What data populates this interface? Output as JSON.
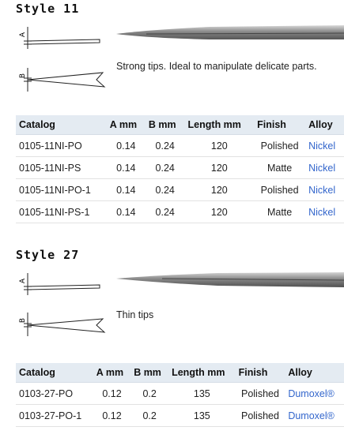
{
  "styles": [
    {
      "title": "Style 11",
      "description": "Strong tips. Ideal to manipulate delicate parts.",
      "table": {
        "headers": [
          "Catalog",
          "A mm",
          "B mm",
          "Length mm",
          "Finish",
          "Alloy"
        ],
        "rows": [
          [
            "0105-11NI-PO",
            "0.14",
            "0.24",
            "120",
            "Polished",
            "Nickel"
          ],
          [
            "0105-11NI-PS",
            "0.14",
            "0.24",
            "120",
            "Matte",
            "Nickel"
          ],
          [
            "0105-11NI-PO-1",
            "0.14",
            "0.24",
            "120",
            "Polished",
            "Nickel"
          ],
          [
            "0105-11NI-PS-1",
            "0.14",
            "0.24",
            "120",
            "Matte",
            "Nickel"
          ]
        ]
      }
    },
    {
      "title": "Style 27",
      "description": "Thin tips",
      "table": {
        "headers": [
          "Catalog",
          "A mm",
          "B mm",
          "Length mm",
          "Finish",
          "Alloy"
        ],
        "rows": [
          [
            "0103-27-PO",
            "0.12",
            "0.2",
            "135",
            "Polished",
            "Dumoxel®"
          ],
          [
            "0103-27-PO-1",
            "0.12",
            "0.2",
            "135",
            "Polished",
            "Dumoxel®"
          ]
        ]
      }
    }
  ],
  "diagram_labels": {
    "a": "A",
    "b": "B"
  },
  "colors": {
    "header_bg": "#e4ebf2",
    "link": "#3366cc"
  }
}
